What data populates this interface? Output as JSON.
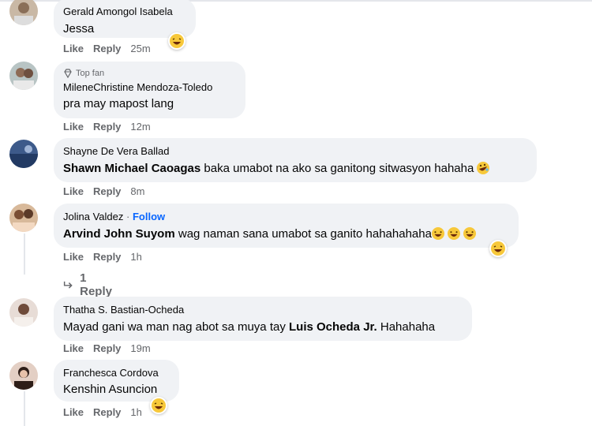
{
  "actions": {
    "like": "Like",
    "reply": "Reply"
  },
  "comments": [
    {
      "author": "Gerald Amongol Isabela",
      "mention": "Jessa",
      "text": "",
      "time": "25m"
    },
    {
      "badge": "Top fan",
      "author": "MileneChristine Mendoza-Toledo",
      "mention": "",
      "text": "pra may mapost lang",
      "time": "12m"
    },
    {
      "author": "Shayne De Vera Ballad",
      "mention": "Shawn Michael Caoagas",
      "text": " baka umabot na ako sa ganitong sitwasyon hahaha",
      "time": "8m"
    },
    {
      "author": "Jolina Valdez",
      "follow": "Follow",
      "mention": "Arvind John Suyom",
      "text": " wag naman sana umabot sa ganito hahahahaha",
      "time": "1h",
      "replies": "1 Reply"
    },
    {
      "author": "Thatha S. Bastian-Ocheda",
      "text_before": "Mayad gani wa man nag abot sa muya tay ",
      "mention": "Luis Ocheda Jr.",
      "text_after": " Hahahaha",
      "time": "19m"
    },
    {
      "author": "Franchesca Cordova",
      "mention": "Kenshin Asuncion",
      "text": "",
      "time": "1h"
    }
  ],
  "colors": {
    "bubble": "#f0f2f5",
    "meta": "#65676b",
    "follow": "#0866ff",
    "emoji": "#f7c83a"
  },
  "icons": [
    "laughing-emoji-icon",
    "rofl-emoji-icon",
    "top-fan-diamond-icon",
    "reply-arrow-icon"
  ]
}
